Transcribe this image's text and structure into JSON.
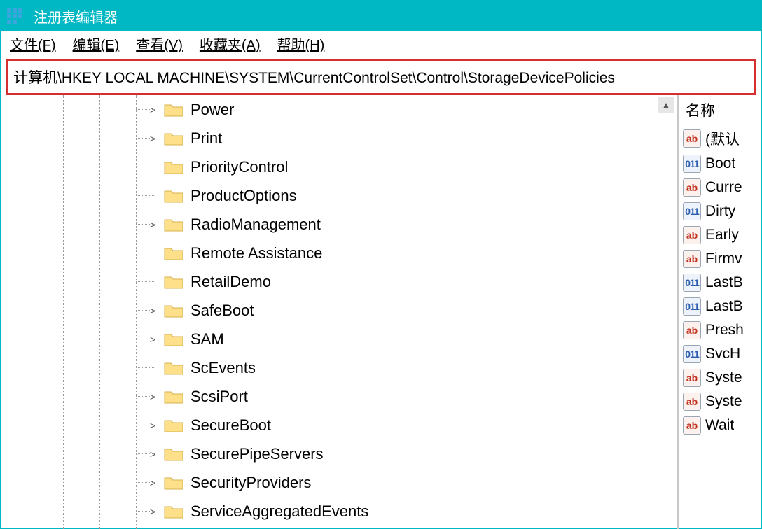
{
  "window": {
    "title": "注册表编辑器"
  },
  "menu": {
    "file": "文件(F)",
    "edit": "编辑(E)",
    "view": "查看(V)",
    "fav": "收藏夹(A)",
    "help": "帮助(H)"
  },
  "addressbar": {
    "value": "计算机\\HKEY LOCAL MACHINE\\SYSTEM\\CurrentControlSet\\Control\\StorageDevicePolicies"
  },
  "tree": {
    "items": [
      {
        "label": "Power",
        "expandable": true
      },
      {
        "label": "Print",
        "expandable": true
      },
      {
        "label": "PriorityControl",
        "expandable": false
      },
      {
        "label": "ProductOptions",
        "expandable": false
      },
      {
        "label": "RadioManagement",
        "expandable": true
      },
      {
        "label": "Remote Assistance",
        "expandable": false
      },
      {
        "label": "RetailDemo",
        "expandable": false
      },
      {
        "label": "SafeBoot",
        "expandable": true
      },
      {
        "label": "SAM",
        "expandable": true
      },
      {
        "label": "ScEvents",
        "expandable": false
      },
      {
        "label": "ScsiPort",
        "expandable": true
      },
      {
        "label": "SecureBoot",
        "expandable": true
      },
      {
        "label": "SecurePipeServers",
        "expandable": true
      },
      {
        "label": "SecurityProviders",
        "expandable": true
      },
      {
        "label": "ServiceAggregatedEvents",
        "expandable": true
      }
    ]
  },
  "values": {
    "header": "名称",
    "items": [
      {
        "type": "ab",
        "label": "(默认"
      },
      {
        "type": "bin",
        "label": "Boot"
      },
      {
        "type": "ab",
        "label": "Curre"
      },
      {
        "type": "bin",
        "label": "Dirty"
      },
      {
        "type": "ab",
        "label": "Early"
      },
      {
        "type": "ab",
        "label": "Firmv"
      },
      {
        "type": "bin",
        "label": "LastB"
      },
      {
        "type": "bin",
        "label": "LastB"
      },
      {
        "type": "ab",
        "label": "Presh"
      },
      {
        "type": "bin",
        "label": "SvcH"
      },
      {
        "type": "ab",
        "label": "Syste"
      },
      {
        "type": "ab",
        "label": "Syste"
      },
      {
        "type": "ab",
        "label": "Wait"
      }
    ]
  }
}
